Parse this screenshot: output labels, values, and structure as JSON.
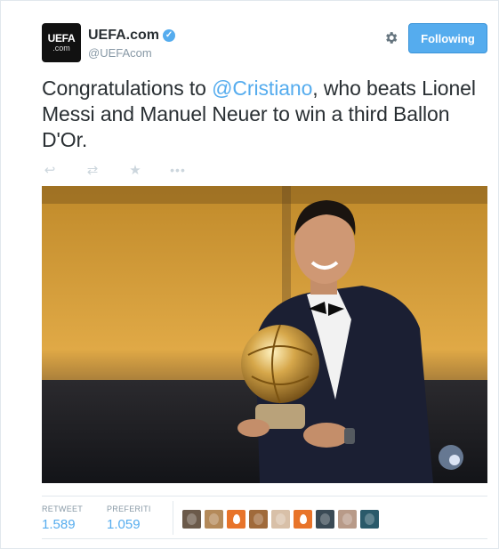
{
  "tweet": {
    "avatar": {
      "line1": "UEFA",
      "line2": ".com"
    },
    "user_name": "UEFA.com",
    "verified_icon": "verified-badge-icon",
    "handle": "@UEFAcom",
    "follow_label": "Following",
    "text_before": "Congratulations to ",
    "mention": "@Cristiano",
    "text_after": ", who beats Lionel Messi and Manuel Neuer to win a third Ballon D'Or.",
    "actions": [
      "reply-icon",
      "retweet-icon",
      "favorite-icon",
      "more-icon"
    ],
    "stats": {
      "retweets_label": "RETWEET",
      "retweets_value": "1.589",
      "favorites_label": "PREFERITI",
      "favorites_value": "1.059"
    },
    "favoriters": [
      {
        "type": "photo",
        "color": "#6b5a4a"
      },
      {
        "type": "photo",
        "color": "#b48a5a"
      },
      {
        "type": "egg",
        "color": "#e8742a"
      },
      {
        "type": "photo",
        "color": "#a06a3a"
      },
      {
        "type": "photo",
        "color": "#d8c0a8"
      },
      {
        "type": "egg",
        "color": "#e8742a"
      },
      {
        "type": "photo",
        "color": "#3a4a55"
      },
      {
        "type": "photo",
        "color": "#b89a88"
      },
      {
        "type": "photo",
        "color": "#2a5a6a"
      }
    ]
  },
  "colors": {
    "accent": "#55acee",
    "text": "#292f33",
    "muted": "#8899a6"
  }
}
